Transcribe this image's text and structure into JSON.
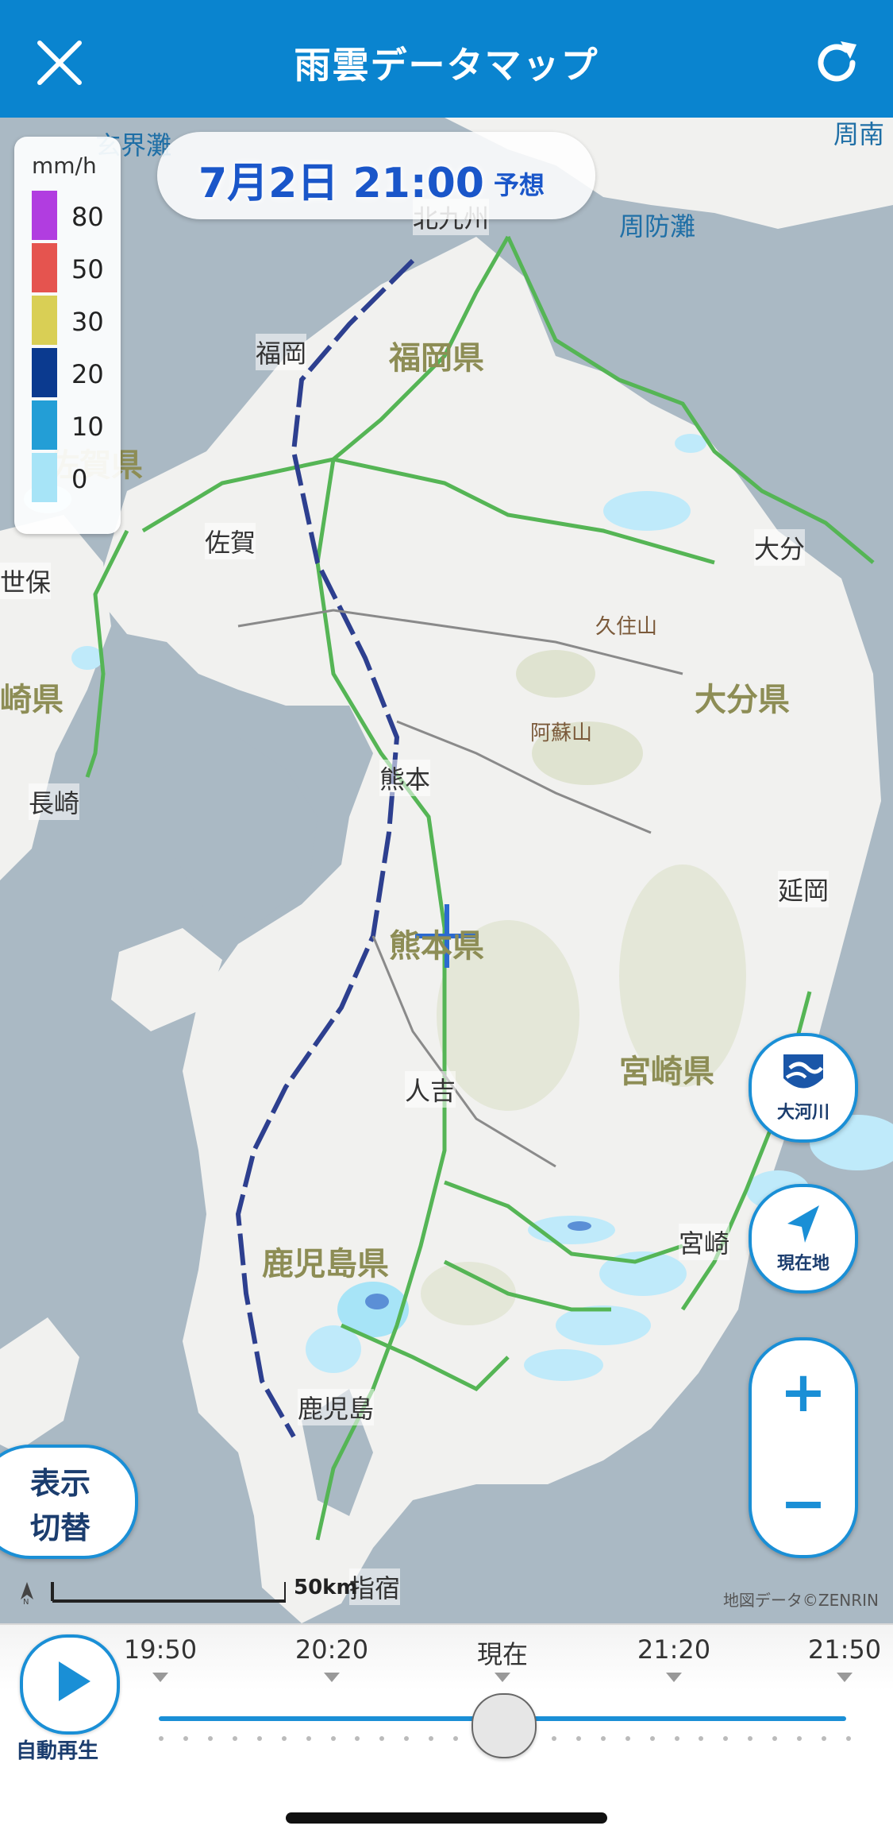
{
  "header": {
    "title": "雨雲データマップ",
    "close_icon": "close-icon",
    "refresh_icon": "refresh-icon",
    "color": "#0a84cf"
  },
  "legend": {
    "unit": "mm/h",
    "items": [
      {
        "value": "80",
        "color": "#b13de0"
      },
      {
        "value": "50",
        "color": "#e5544f"
      },
      {
        "value": "30",
        "color": "#d9cf55"
      },
      {
        "value": "20",
        "color": "#0b3a8f"
      },
      {
        "value": "10",
        "color": "#239ed6"
      },
      {
        "value": "0",
        "color": "#a7e4f7"
      }
    ]
  },
  "time": {
    "date_time": "7月2日 21:00",
    "forecast_label": "予想"
  },
  "map": {
    "prefectures": [
      "福岡県",
      "佐賀県",
      "大分県",
      "熊本県",
      "宮崎県",
      "鹿児島県",
      "崎県"
    ],
    "cities": [
      "福岡",
      "佐賀",
      "大分",
      "熊本",
      "長崎",
      "延岡",
      "人吉",
      "宮崎",
      "鹿児島",
      "指宿",
      "北九州",
      "世保"
    ],
    "mountains": [
      "久住山",
      "阿蘇山"
    ],
    "seas": [
      "玄界灘",
      "周防灘",
      "周南"
    ],
    "credit": "地図データ©ZENRIN",
    "scale_label": "50km",
    "north_label": "N"
  },
  "controls": {
    "river_label": "大河川",
    "location_label": "現在地",
    "zoom_in": "+",
    "zoom_out": "−",
    "display_toggle_line1": "表示",
    "display_toggle_line2": "切替"
  },
  "timeline": {
    "play_label": "自動再生",
    "ticks": [
      "19:50",
      "20:20",
      "現在",
      "21:20",
      "21:50"
    ],
    "current_position": 0.5
  }
}
